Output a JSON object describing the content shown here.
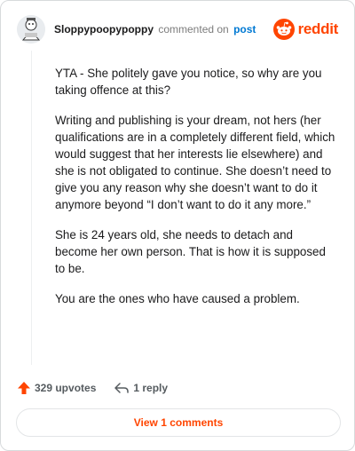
{
  "header": {
    "username": "Sloppypoopypoppy",
    "commented_text": "commented on",
    "post_link": "post",
    "brand_wordmark": "reddit",
    "brand_color": "#ff4500",
    "link_color": "#0079d3"
  },
  "comment": {
    "paragraphs": [
      "YTA - She politely gave you notice, so why are you taking offence at this?",
      "Writing and publishing is your dream, not hers (her qualifications are in a completely different field, which would suggest that her interests lie elsewhere) and she is not obligated to continue. She doesn’t need to give you any reason why she doesn’t want to do it anymore beyond “I don’t want to do it any more.”",
      "She is 24 years old, she needs to detach and become her own person. That is how it is supposed to be.",
      "You are the ones who have caused a problem."
    ]
  },
  "actions": {
    "upvote_icon": "upvote-arrow-icon",
    "upvotes": "329 upvotes",
    "reply_icon": "reply-arrow-icon",
    "replies": "1 reply"
  },
  "footer": {
    "view_comments_label": "View 1 comments"
  }
}
